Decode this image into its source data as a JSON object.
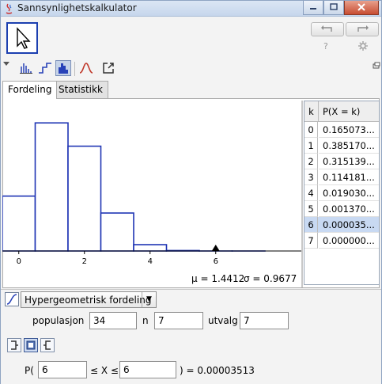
{
  "window": {
    "title": "Sannsynlighetskalkulator"
  },
  "toolbar": {
    "undo_icon": "undo-arrow-icon",
    "redo_icon": "redo-arrow-icon",
    "help_label": "?",
    "settings_icon": "gear-icon"
  },
  "tabs": [
    {
      "label": "Fordeling"
    },
    {
      "label": "Statistikk"
    }
  ],
  "chart_data": {
    "type": "bar",
    "categories": [
      0,
      1,
      2,
      3,
      4,
      5,
      6,
      7
    ],
    "values": [
      0.165073,
      0.38517,
      0.315139,
      0.114181,
      0.01903,
      0.00137,
      3.5e-05,
      0.0
    ],
    "xticks": [
      "0",
      "2",
      "4",
      "6"
    ],
    "xlim": [
      -0.5,
      7.5
    ],
    "ylim": [
      0,
      0.4
    ],
    "marker_at": 6,
    "color": "#1f35b4"
  },
  "stats": {
    "mu_label": "μ = 1.4412",
    "sigma_label": "σ = 0.9677"
  },
  "table": {
    "headers": {
      "k": "k",
      "p": "P(X = k)"
    },
    "rows": [
      {
        "k": "0",
        "p": "0.165073..."
      },
      {
        "k": "1",
        "p": "0.385170..."
      },
      {
        "k": "2",
        "p": "0.315139..."
      },
      {
        "k": "3",
        "p": "0.114181..."
      },
      {
        "k": "4",
        "p": "0.019030..."
      },
      {
        "k": "5",
        "p": "0.001370..."
      },
      {
        "k": "6",
        "p": "0.000035..."
      },
      {
        "k": "7",
        "p": "0.000000..."
      }
    ],
    "selected_row": 6
  },
  "distribution": {
    "selected": "Hypergeometrisk fordeling"
  },
  "params": {
    "population_label": "populasjon",
    "population_value": "34",
    "n_label": "n",
    "n_value": "7",
    "sample_label": "utvalg",
    "sample_value": "7"
  },
  "probability": {
    "p_open": "P(",
    "low_value": "6",
    "le_x_le": "≤ X ≤",
    "high_value": "6",
    "result_text": ") =  0.00003513"
  }
}
